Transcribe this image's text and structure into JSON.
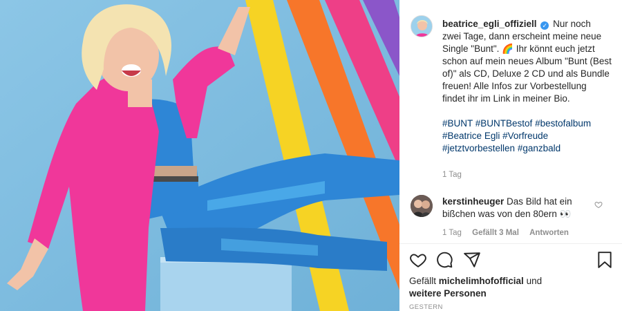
{
  "post": {
    "username": "beatrice_egli_offiziell",
    "verified_glyph": "✓",
    "caption": "Nur noch zwei Tage, dann erscheint meine neue Single \"Bunt\". 🌈 Ihr könnt euch jetzt schon auf mein neues Album \"Bunt (Best of)\" als CD, Deluxe 2 CD und als Bundle freuen! Alle Infos zur Vorbestellung findet ihr im Link in meiner Bio.",
    "hashtags": [
      "#BUNT",
      "#BUNTBestof",
      "#bestofalbum",
      "#Beatrice",
      "Egli",
      "#Vorfreude",
      "#jetztvorbestellen",
      "#ganzbald"
    ],
    "time": "1 Tag"
  },
  "comment": {
    "username": "kerstinheuger",
    "text": "Das Bild hat ein bißchen was von den 80ern 👀",
    "time": "1 Tag",
    "likes": "Gefällt 3 Mal",
    "reply_label": "Antworten"
  },
  "likes": {
    "prefix": "Gefällt",
    "user": "michelimhofofficial",
    "middle": "und",
    "others": "weitere Personen"
  },
  "date_label": "GESTERN",
  "icons": {
    "like": "heart-icon",
    "comment": "comment-icon",
    "share": "share-icon",
    "save": "bookmark-icon",
    "comment_like": "heart-icon"
  },
  "colors": {
    "link": "#00376b",
    "muted": "#8e8e8e",
    "verified": "#3897f0",
    "stripe_yellow": "#f6d324",
    "stripe_orange": "#f7762a",
    "stripe_pink": "#ee3f87",
    "jacket_pink": "#f0379a",
    "outfit_blue": "#2e86d6"
  }
}
